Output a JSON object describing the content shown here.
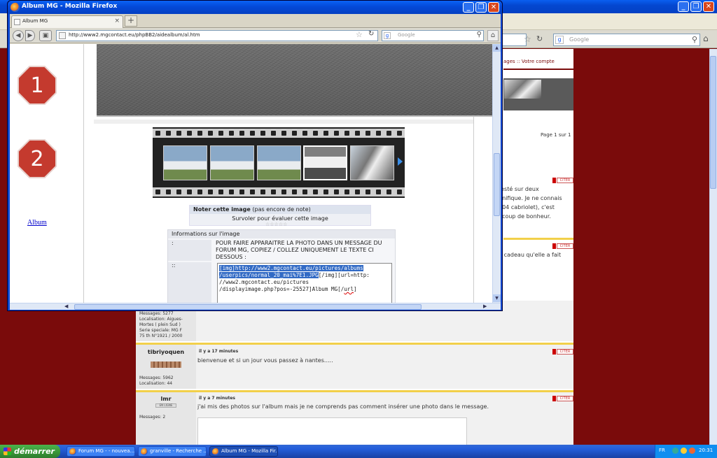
{
  "background_window": {
    "search_placeholder": "Google",
    "forum_links": "ages :: Votre compte",
    "page_info": "Page 1 sur 1",
    "fragments": [
      "testé sur deux",
      "gnifique. Je ne connais",
      "304 cabriolet), c'est",
      "ucoup de bonheur.",
      "u cadeau qu'elle a fait"
    ],
    "quote_label": "CITER",
    "posts": [
      {
        "meta": [
          "Messages: 5277",
          "Localisation: Aigues-",
          "Mortes ( plein Sud )",
          "Serie speciale: MG F",
          "75 th N°1921 / 2000"
        ]
      },
      {
        "author": "tibriyoquen",
        "time": "il y a 17 minutes",
        "body": "bienvenue et si un jour vous passez à nantes.....",
        "meta": [
          "Messages: 5962",
          "Localisation: 44"
        ]
      },
      {
        "author": "lmr",
        "rank": "EN LIGNE",
        "time": "il y a 7 minutes",
        "body": "j'ai mis des photos sur l'album mais je ne comprends pas comment insérer une photo dans le message.",
        "meta": [
          "Messages: 2"
        ]
      }
    ]
  },
  "popup": {
    "title": "Album MG - Mozilla Firefox",
    "tab_label": "Album MG",
    "url": "http://www2.mgcontact.eu/phpBB2/aidealbum/al.htm",
    "search_placeholder": "Google",
    "steps": [
      "1",
      "2"
    ],
    "album_link": "Album",
    "rating": {
      "title": "Noter cette image",
      "note": "(pas encore de note)",
      "hint": "Survoler pour évaluer cette image",
      "stars": "☆☆☆☆☆"
    },
    "info": {
      "title": "Informations sur l'image",
      "label_1": ":",
      "label_2": "::",
      "instructions": "POUR FAIRE APPARAITRE LA PHOTO DANS UN MESSAGE DU FORUM MG, COPIEZ / COLLEZ UNIQUEMENT LE TEXTE CI DESSOUS :",
      "code_lines": [
        {
          "hl": "[img]http://www2.mgcontact.eu/pictures/albums",
          "rest": ""
        },
        {
          "hl": "/userpics/normal_20_mai%7E1.JPG",
          "rest": "[/img][url=http:"
        },
        {
          "hl": "",
          "rest": "//www2.mgcontact.eu/pictures"
        },
        {
          "hl": "",
          "rest": "/displayimage.php?pos=-25527]Album MG[/"
        },
        {
          "hl": "",
          "rest": ""
        }
      ],
      "code_tail": "url",
      "code_end": "]"
    }
  },
  "taskbar": {
    "start_label": "démarrer",
    "tasks": [
      "Forum MG - - nouvea...",
      "granville - Recherche ...",
      "Album MG - Mozilla Fir..."
    ],
    "lang": "FR",
    "clock": "20:31"
  },
  "colors": {
    "accent": "#7a0b0b",
    "xp_blue": "#0449d8",
    "step_red": "#c43a2e"
  }
}
